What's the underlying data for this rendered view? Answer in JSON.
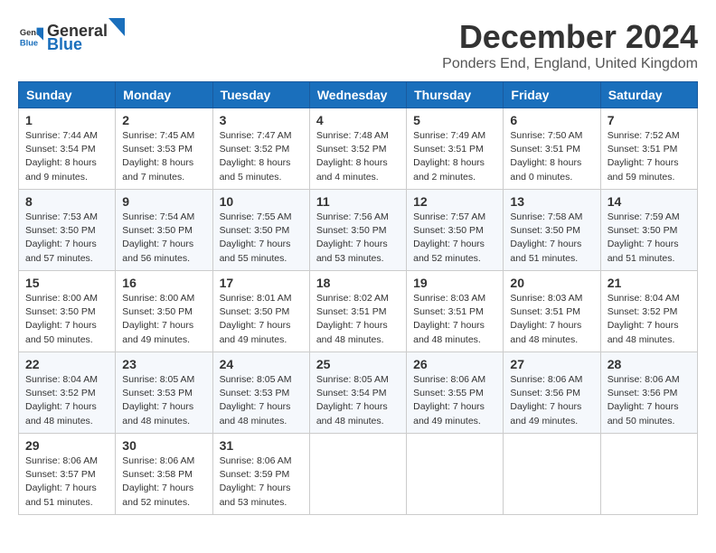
{
  "logo": {
    "general": "General",
    "blue": "Blue"
  },
  "title": "December 2024",
  "subtitle": "Ponders End, England, United Kingdom",
  "headers": [
    "Sunday",
    "Monday",
    "Tuesday",
    "Wednesday",
    "Thursday",
    "Friday",
    "Saturday"
  ],
  "weeks": [
    [
      {
        "day": "1",
        "sunrise": "7:44 AM",
        "sunset": "3:54 PM",
        "daylight": "8 hours and 9 minutes."
      },
      {
        "day": "2",
        "sunrise": "7:45 AM",
        "sunset": "3:53 PM",
        "daylight": "8 hours and 7 minutes."
      },
      {
        "day": "3",
        "sunrise": "7:47 AM",
        "sunset": "3:52 PM",
        "daylight": "8 hours and 5 minutes."
      },
      {
        "day": "4",
        "sunrise": "7:48 AM",
        "sunset": "3:52 PM",
        "daylight": "8 hours and 4 minutes."
      },
      {
        "day": "5",
        "sunrise": "7:49 AM",
        "sunset": "3:51 PM",
        "daylight": "8 hours and 2 minutes."
      },
      {
        "day": "6",
        "sunrise": "7:50 AM",
        "sunset": "3:51 PM",
        "daylight": "8 hours and 0 minutes."
      },
      {
        "day": "7",
        "sunrise": "7:52 AM",
        "sunset": "3:51 PM",
        "daylight": "7 hours and 59 minutes."
      }
    ],
    [
      {
        "day": "8",
        "sunrise": "7:53 AM",
        "sunset": "3:50 PM",
        "daylight": "7 hours and 57 minutes."
      },
      {
        "day": "9",
        "sunrise": "7:54 AM",
        "sunset": "3:50 PM",
        "daylight": "7 hours and 56 minutes."
      },
      {
        "day": "10",
        "sunrise": "7:55 AM",
        "sunset": "3:50 PM",
        "daylight": "7 hours and 55 minutes."
      },
      {
        "day": "11",
        "sunrise": "7:56 AM",
        "sunset": "3:50 PM",
        "daylight": "7 hours and 53 minutes."
      },
      {
        "day": "12",
        "sunrise": "7:57 AM",
        "sunset": "3:50 PM",
        "daylight": "7 hours and 52 minutes."
      },
      {
        "day": "13",
        "sunrise": "7:58 AM",
        "sunset": "3:50 PM",
        "daylight": "7 hours and 51 minutes."
      },
      {
        "day": "14",
        "sunrise": "7:59 AM",
        "sunset": "3:50 PM",
        "daylight": "7 hours and 51 minutes."
      }
    ],
    [
      {
        "day": "15",
        "sunrise": "8:00 AM",
        "sunset": "3:50 PM",
        "daylight": "7 hours and 50 minutes."
      },
      {
        "day": "16",
        "sunrise": "8:00 AM",
        "sunset": "3:50 PM",
        "daylight": "7 hours and 49 minutes."
      },
      {
        "day": "17",
        "sunrise": "8:01 AM",
        "sunset": "3:50 PM",
        "daylight": "7 hours and 49 minutes."
      },
      {
        "day": "18",
        "sunrise": "8:02 AM",
        "sunset": "3:51 PM",
        "daylight": "7 hours and 48 minutes."
      },
      {
        "day": "19",
        "sunrise": "8:03 AM",
        "sunset": "3:51 PM",
        "daylight": "7 hours and 48 minutes."
      },
      {
        "day": "20",
        "sunrise": "8:03 AM",
        "sunset": "3:51 PM",
        "daylight": "7 hours and 48 minutes."
      },
      {
        "day": "21",
        "sunrise": "8:04 AM",
        "sunset": "3:52 PM",
        "daylight": "7 hours and 48 minutes."
      }
    ],
    [
      {
        "day": "22",
        "sunrise": "8:04 AM",
        "sunset": "3:52 PM",
        "daylight": "7 hours and 48 minutes."
      },
      {
        "day": "23",
        "sunrise": "8:05 AM",
        "sunset": "3:53 PM",
        "daylight": "7 hours and 48 minutes."
      },
      {
        "day": "24",
        "sunrise": "8:05 AM",
        "sunset": "3:53 PM",
        "daylight": "7 hours and 48 minutes."
      },
      {
        "day": "25",
        "sunrise": "8:05 AM",
        "sunset": "3:54 PM",
        "daylight": "7 hours and 48 minutes."
      },
      {
        "day": "26",
        "sunrise": "8:06 AM",
        "sunset": "3:55 PM",
        "daylight": "7 hours and 49 minutes."
      },
      {
        "day": "27",
        "sunrise": "8:06 AM",
        "sunset": "3:56 PM",
        "daylight": "7 hours and 49 minutes."
      },
      {
        "day": "28",
        "sunrise": "8:06 AM",
        "sunset": "3:56 PM",
        "daylight": "7 hours and 50 minutes."
      }
    ],
    [
      {
        "day": "29",
        "sunrise": "8:06 AM",
        "sunset": "3:57 PM",
        "daylight": "7 hours and 51 minutes."
      },
      {
        "day": "30",
        "sunrise": "8:06 AM",
        "sunset": "3:58 PM",
        "daylight": "7 hours and 52 minutes."
      },
      {
        "day": "31",
        "sunrise": "8:06 AM",
        "sunset": "3:59 PM",
        "daylight": "7 hours and 53 minutes."
      },
      null,
      null,
      null,
      null
    ]
  ]
}
